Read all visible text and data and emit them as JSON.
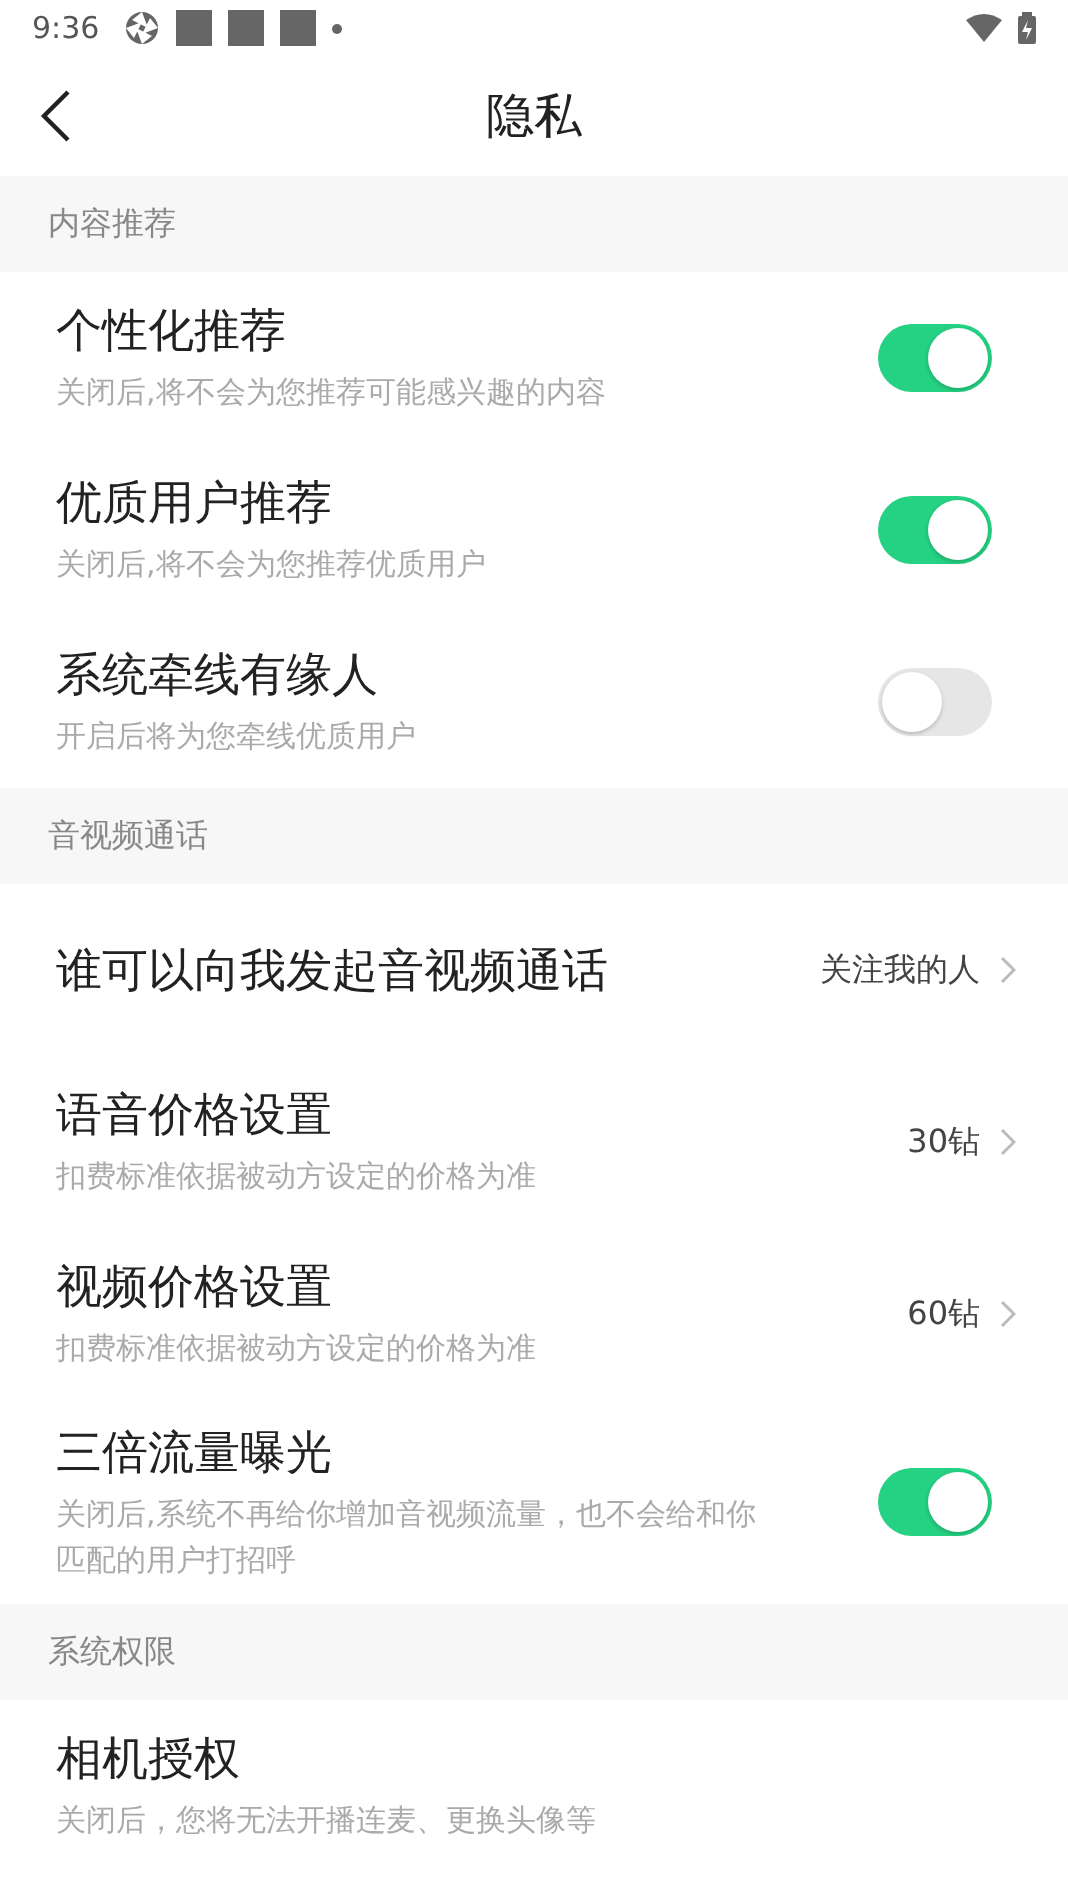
{
  "status_bar": {
    "time": "9:36"
  },
  "header": {
    "title": "隐私"
  },
  "sections": [
    {
      "title": "内容推荐",
      "rows": [
        {
          "kind": "toggle",
          "title": "个性化推荐",
          "subtitle": "关闭后,将不会为您推荐可能感兴趣的内容",
          "on": true
        },
        {
          "kind": "toggle",
          "title": "优质用户推荐",
          "subtitle": "关闭后,将不会为您推荐优质用户",
          "on": true
        },
        {
          "kind": "toggle",
          "title": "系统牵线有缘人",
          "subtitle": "开启后将为您牵线优质用户",
          "on": false
        }
      ]
    },
    {
      "title": "音视频通话",
      "rows": [
        {
          "kind": "value",
          "title": "谁可以向我发起音视频通话",
          "value": "关注我的人"
        },
        {
          "kind": "value",
          "title": "语音价格设置",
          "subtitle": "扣费标准依据被动方设定的价格为准",
          "value": "30钻"
        },
        {
          "kind": "value",
          "title": "视频价格设置",
          "subtitle": "扣费标准依据被动方设定的价格为准",
          "value": "60钻"
        },
        {
          "kind": "toggle",
          "title": "三倍流量曝光",
          "subtitle": "关闭后,系统不再给你增加音视频流量，也不会给和你匹配的用户打招呼",
          "on": true
        }
      ]
    },
    {
      "title": "系统权限",
      "rows": [
        {
          "kind": "plain",
          "title": "相机授权",
          "subtitle": "关闭后，您将无法开播连麦、更换头像等"
        }
      ]
    }
  ]
}
